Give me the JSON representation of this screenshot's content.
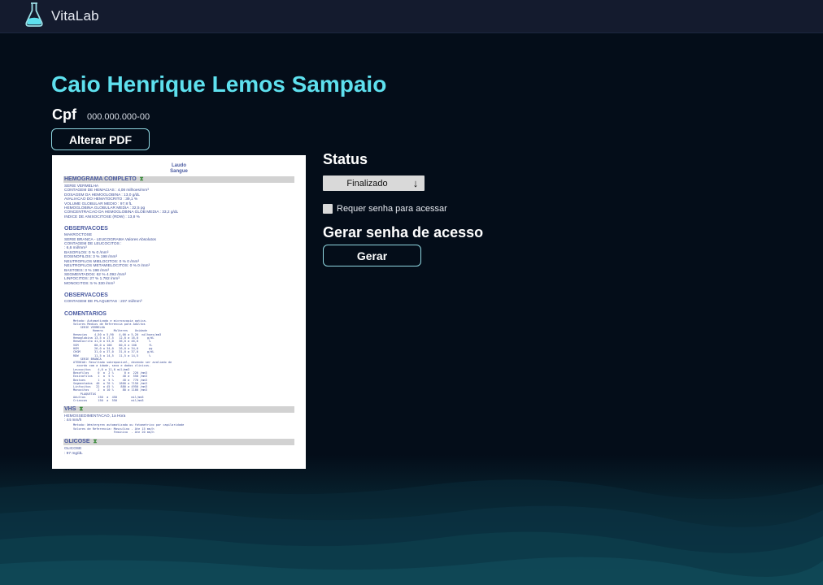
{
  "app": {
    "name": "VitaLab",
    "logo_icon": "flask-icon"
  },
  "colors": {
    "accent": "#5ee0ee",
    "background": "#040d19",
    "topbar": "#141b2e"
  },
  "patient": {
    "name": "Caio Henrique Lemos Sampaio",
    "cpf_label": "Cpf",
    "cpf_value": "000.000.000-00"
  },
  "actions": {
    "change_pdf": "Alterar PDF",
    "generate": "Gerar"
  },
  "status": {
    "label": "Status",
    "selected": "Finalizado",
    "dropdown_icon": "arrow-down-icon"
  },
  "password": {
    "checkbox_label": "Requer senha para acessar",
    "checked": false,
    "section_title": "Gerar senha de acesso"
  },
  "pdf_preview": {
    "header": [
      "Laudo",
      "Sangue"
    ],
    "hemograma": {
      "title": "HEMOGRAMA COMPLETO",
      "lines": [
        "SERIE VERMELHA",
        "CONTAGEM DE HEMACIAS : 4,08 milhoes/mm³",
        "DOSAGEM DA HEMOGLOBINA : 13,0 g/dL",
        "AVALIACAO DO HEMATOCRITO : 39,1 %",
        "VOLUME GLOBULAR MEDIO : 97,8 fL",
        "HEMOGLOBINA GLOBULAR MEDIA : 32,5 pg",
        "CONCENTRACAO DA HEMOGLOBINA GLOB MEDIA : 33,2 g/dL",
        "INDICE DE ANISOCITOSE (RDW) : 13,8 %"
      ]
    },
    "obs1": {
      "title": "OBSERVACOES",
      "lines": [
        "MAKROCTOSE",
        "SERIE BRANCA - LEUCOGRAMA              Valores Absolutos",
        "CONTAGEM DE LEUCOCITOS :",
        ": 6,6 mil/mm³",
        "BASOFILOS: 0 %        0 /mm³",
        "EOSINOFILOS: 3 %    198 /mm³",
        "NEUTROFILOS MIELOCITOS: 0 %        0 /mm³",
        "NEUTROFILOS METAMIELOCITOS: 0 %   0 /mm³",
        "BASTOES: 3 %   198 /mm³",
        "SEGMENTADOS: 62 %  4.092 /mm³",
        "LINFOCITOS: 27 %   1.782 /mm³",
        "MONOCITOS: 5 %   330 /mm³"
      ]
    },
    "obs2": {
      "title": "OBSERVACOES",
      "lines": [
        "CONTAGEM DE PLAQUETAS : 237 mil/mm³"
      ]
    },
    "comentarios": {
      "title": "COMENTARIOS",
      "lines": [
        "Metodo: Automatizado e microscopia optica.",
        "Valores Medios de Referencia para Adultos",
        "    SERIE VERMELHA",
        "           Homens      Mulheres    Unidade",
        "Hemacias    4,50 a 5,90   4,00 a 5,20  milhoes/mm3",
        "Hemoglobina 13,5 a 17,5   12,0 a 16,0     g/dL",
        "Hematocrito 41,0 a 53,0   36,0 a 46,0      %",
        "VGM         80,0 a 100    80,0 a 100       fL",
        "HGM         26,0 a 34,0   26,0 a 34,0      pg",
        "CHGM        31,0 a 37,0   31,0 a 37,0     g/dL",
        "RDW         11,5 a 14,5   11,5 a 14,5      %",
        "    SERIE BRANCA",
        "ATENCAO: Resultado sobreponivel, devendo ser avaliado de",
        "  acordo com a idade, sexo e dados clinicos.",
        "Leucocitos    4,0 a 11,0 mil/mm3",
        "Basofilos     0  a  2 %      0 a  220 /mm3",
        "Eosinofilos   1  a  5 %     40 a  550 /mm3",
        "Bastoes       1  a  5 %     40 a  770 /mm3",
        "Segmentados  40  a 70 %   1800 a 7150 /mm3",
        "Linfocitos   22  a 45 %    880 a 4950 /mm3",
        "Monocitos     2  a 10 %     80 a 1100 /mm3",
        "    PLAQUETAS",
        "Adultos       150  a  450        mil/mm3",
        "Criancas      150  a  550        mil/mm3"
      ]
    },
    "vhs": {
      "title": "VHS",
      "lines": [
        "HEMOSSEDIMENTACAO, 1a Hora",
        ": 44 mm/h"
      ],
      "method": [
        "Metodo: Westergren automatizado ou fotometrico por capilaridade",
        "Valores de Referencia: Masculino - Ate 15 mm/h",
        "                       Feminino  - Ate 20 mm/h"
      ]
    },
    "glicose": {
      "title": "GLICOSE",
      "lines": [
        "GLICOSE",
        ": 97 mg/dL"
      ]
    }
  }
}
